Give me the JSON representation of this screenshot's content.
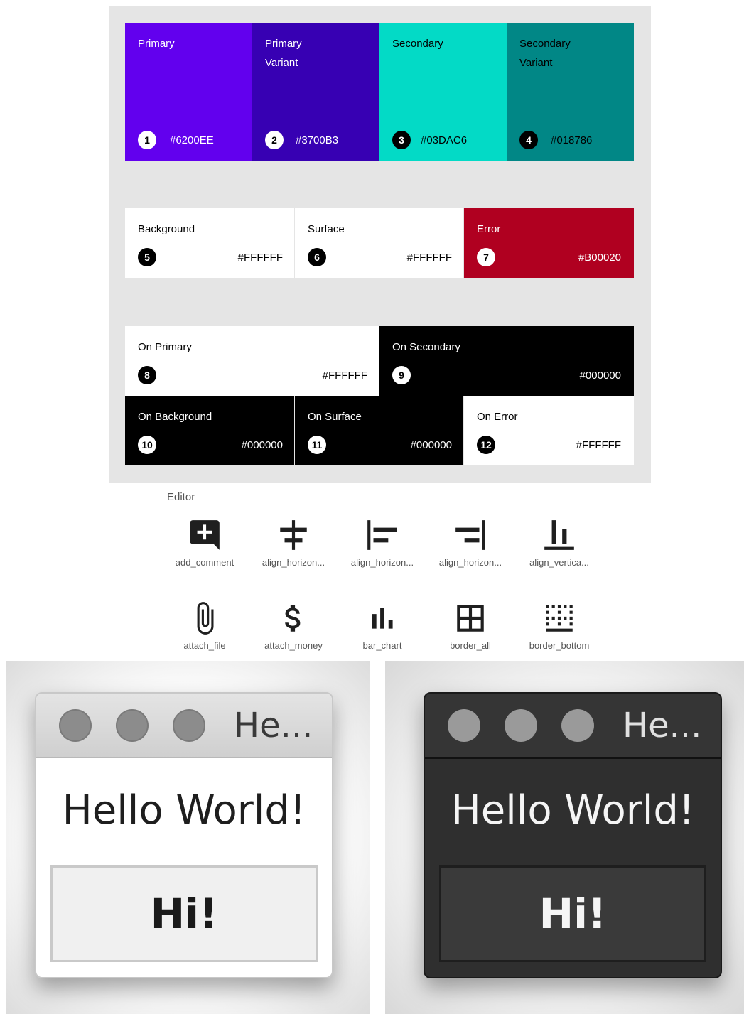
{
  "palette": {
    "primary": [
      {
        "name": "Primary",
        "hex": "#6200EE",
        "num": "1",
        "color": "#6200ee",
        "text": "#ffffff"
      },
      {
        "name": "Primary Variant",
        "hex": "#3700B3",
        "num": "2",
        "color": "#3700b3",
        "text": "#ffffff"
      },
      {
        "name": "Secondary",
        "hex": "#03DAC6",
        "num": "3",
        "color": "#03dac6",
        "text": "#000000"
      },
      {
        "name": "Secondary Variant",
        "hex": "#018786",
        "num": "4",
        "color": "#018786",
        "text": "#000000"
      }
    ],
    "surfaces": [
      {
        "name": "Background",
        "hex": "#FFFFFF",
        "num": "5",
        "color": "#ffffff",
        "text": "#000000"
      },
      {
        "name": "Surface",
        "hex": "#FFFFFF",
        "num": "6",
        "color": "#ffffff",
        "text": "#000000"
      },
      {
        "name": "Error",
        "hex": "#B00020",
        "num": "7",
        "color": "#b00020",
        "text": "#ffffff"
      }
    ],
    "on_row1": [
      {
        "name": "On Primary",
        "hex": "#FFFFFF",
        "num": "8",
        "color": "#ffffff",
        "text": "#000000"
      },
      {
        "name": "On Secondary",
        "hex": "#000000",
        "num": "9",
        "color": "#000000",
        "text": "#ffffff"
      }
    ],
    "on_row2": [
      {
        "name": "On Background",
        "hex": "#000000",
        "num": "10",
        "color": "#000000",
        "text": "#ffffff"
      },
      {
        "name": "On Surface",
        "hex": "#000000",
        "num": "11",
        "color": "#000000",
        "text": "#ffffff"
      },
      {
        "name": "On Error",
        "hex": "#FFFFFF",
        "num": "12",
        "color": "#ffffff",
        "text": "#000000"
      }
    ]
  },
  "editor": {
    "title": "Editor",
    "icons": [
      {
        "name": "add-comment-icon",
        "label": "add_comment"
      },
      {
        "name": "align-horizontal-center-icon",
        "label": "align_horizon..."
      },
      {
        "name": "align-horizontal-left-icon",
        "label": "align_horizon..."
      },
      {
        "name": "align-horizontal-right-icon",
        "label": "align_horizon..."
      },
      {
        "name": "align-vertical-bottom-icon",
        "label": "align_vertica..."
      },
      {
        "name": "attach-file-icon",
        "label": "attach_file"
      },
      {
        "name": "attach-money-icon",
        "label": "attach_money"
      },
      {
        "name": "bar-chart-icon",
        "label": "bar_chart"
      },
      {
        "name": "border-all-icon",
        "label": "border_all"
      },
      {
        "name": "border-bottom-icon",
        "label": "border_bottom"
      }
    ]
  },
  "windows": {
    "light": {
      "title": "He...",
      "message": "Hello World!",
      "button": "Hi!"
    },
    "dark": {
      "title": "He...",
      "message": "Hello World!",
      "button": "Hi!"
    }
  }
}
